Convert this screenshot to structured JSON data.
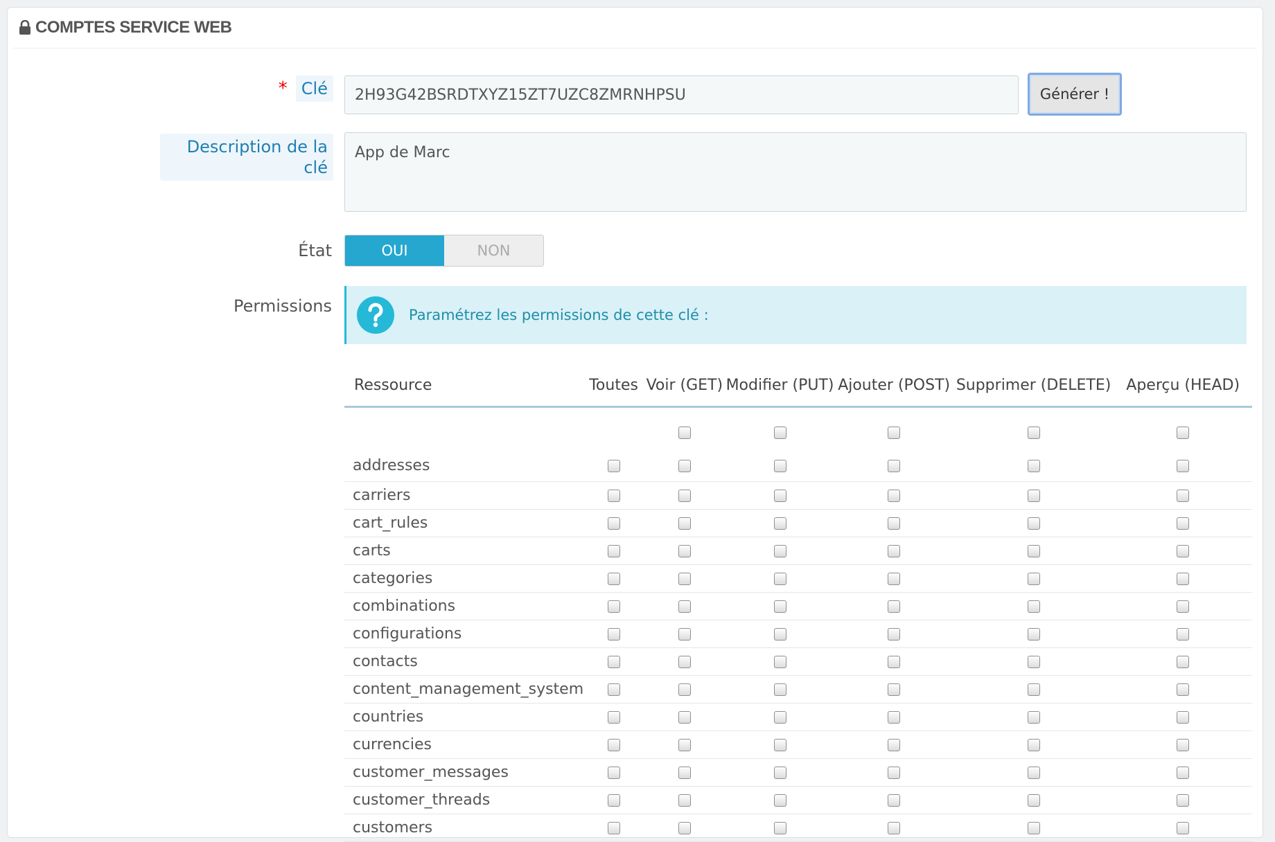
{
  "panel": {
    "title": "COMPTES SERVICE WEB",
    "icon": "lock-icon"
  },
  "form": {
    "key_label": "Clé",
    "key_required_mark": "*",
    "key_value": "2H93G42BSRDTXYZ15ZT7UZC8ZMRNHPSU",
    "generate_label": "Générer !",
    "description_label": "Description de la clé",
    "description_value": "App de Marc",
    "status_label": "État",
    "status_on": "OUI",
    "status_off": "NON",
    "status_selected": "OUI",
    "permissions_label": "Permissions",
    "permissions_info": "Paramétrez les permissions de cette clé :"
  },
  "table": {
    "columns": [
      "Ressource",
      "Toutes",
      "Voir (GET)",
      "Modifier (PUT)",
      "Ajouter (POST)",
      "Supprimer (DELETE)",
      "Aperçu (HEAD)"
    ],
    "rows": [
      "addresses",
      "carriers",
      "cart_rules",
      "carts",
      "categories",
      "combinations",
      "configurations",
      "contacts",
      "content_management_system",
      "countries",
      "currencies",
      "customer_messages",
      "customer_threads",
      "customers"
    ]
  },
  "colors": {
    "accent": "#25a7d0",
    "info_bg": "#d9f1f7",
    "required": "#ee0000"
  }
}
